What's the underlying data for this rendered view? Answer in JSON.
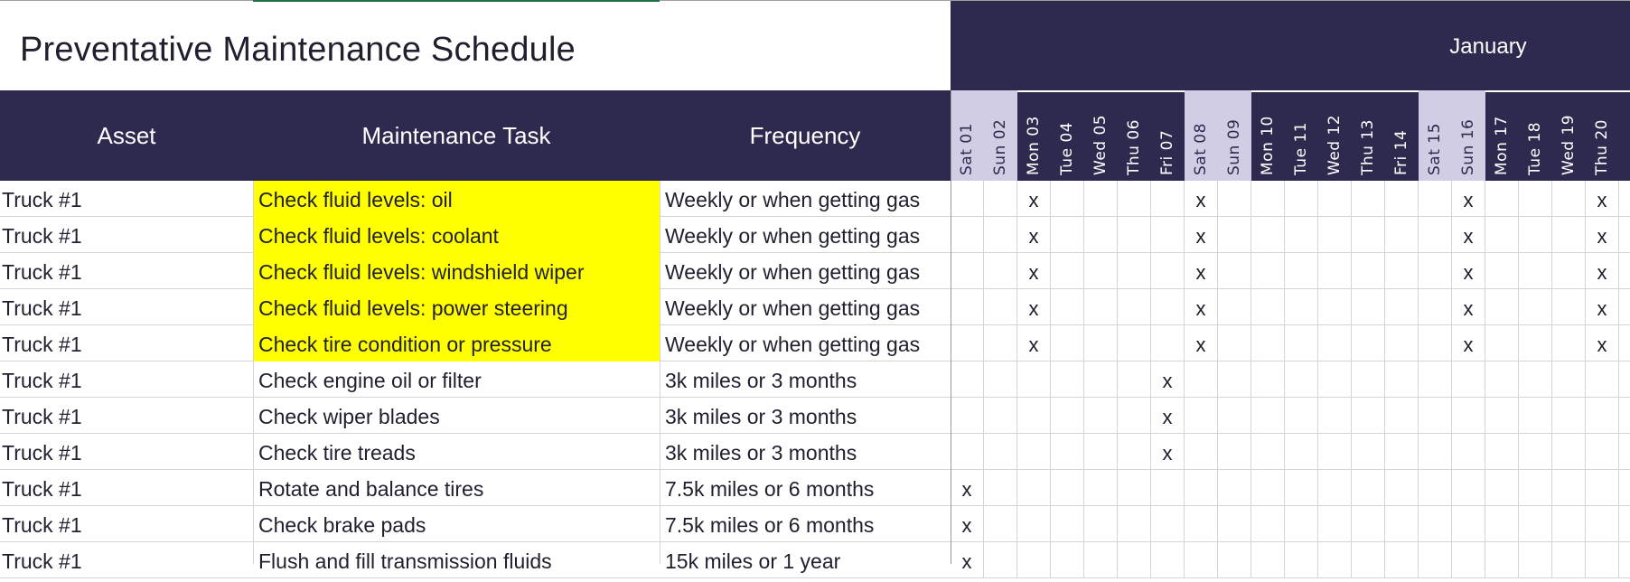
{
  "title": "Preventative Maintenance Schedule",
  "month": "January",
  "columns": {
    "asset": "Asset",
    "task": "Maintenance Task",
    "frequency": "Frequency"
  },
  "days": [
    {
      "label": "Sat 01",
      "weekend": true
    },
    {
      "label": "Sun 02",
      "weekend": true
    },
    {
      "label": "Mon 03",
      "weekend": false
    },
    {
      "label": "Tue 04",
      "weekend": false
    },
    {
      "label": "Wed 05",
      "weekend": false
    },
    {
      "label": "Thu 06",
      "weekend": false
    },
    {
      "label": "Fri 07",
      "weekend": false
    },
    {
      "label": "Sat 08",
      "weekend": true
    },
    {
      "label": "Sun 09",
      "weekend": true
    },
    {
      "label": "Mon 10",
      "weekend": false
    },
    {
      "label": "Tue 11",
      "weekend": false
    },
    {
      "label": "Wed 12",
      "weekend": false
    },
    {
      "label": "Thu 13",
      "weekend": false
    },
    {
      "label": "Fri 14",
      "weekend": false
    },
    {
      "label": "Sat 15",
      "weekend": true
    },
    {
      "label": "Sun 16",
      "weekend": true
    },
    {
      "label": "Mon 17",
      "weekend": false
    },
    {
      "label": "Tue 18",
      "weekend": false
    },
    {
      "label": "Wed 19",
      "weekend": false
    },
    {
      "label": "Thu 20",
      "weekend": false
    },
    {
      "label": "",
      "weekend": false
    }
  ],
  "mark": "x",
  "colors": {
    "header_bg": "#2e294e",
    "weekend_bg": "#d1cde4",
    "highlight": "#ffff00",
    "selection": "#1e7145"
  },
  "rows": [
    {
      "asset": "Truck #1",
      "task": "Check fluid levels: oil",
      "frequency": "Weekly or when getting gas",
      "highlight": true,
      "marks": [
        "Mon 03",
        "Sat 08",
        "Sun 16",
        "Thu 20"
      ]
    },
    {
      "asset": "Truck #1",
      "task": "Check fluid levels: coolant",
      "frequency": "Weekly or when getting gas",
      "highlight": true,
      "marks": [
        "Mon 03",
        "Sat 08",
        "Sun 16",
        "Thu 20"
      ]
    },
    {
      "asset": "Truck #1",
      "task": "Check fluid levels: windshield wiper",
      "frequency": "Weekly or when getting gas",
      "highlight": true,
      "marks": [
        "Mon 03",
        "Sat 08",
        "Sun 16",
        "Thu 20"
      ]
    },
    {
      "asset": "Truck #1",
      "task": "Check fluid levels: power steering",
      "frequency": "Weekly or when getting gas",
      "highlight": true,
      "marks": [
        "Mon 03",
        "Sat 08",
        "Sun 16",
        "Thu 20"
      ]
    },
    {
      "asset": "Truck #1",
      "task": "Check tire condition or pressure",
      "frequency": "Weekly or when getting gas",
      "highlight": true,
      "marks": [
        "Mon 03",
        "Sat 08",
        "Sun 16",
        "Thu 20"
      ]
    },
    {
      "asset": "Truck #1",
      "task": "Check engine oil or filter",
      "frequency": "3k miles or 3 months",
      "highlight": false,
      "marks": [
        "Fri 07"
      ]
    },
    {
      "asset": "Truck #1",
      "task": "Check wiper blades",
      "frequency": "3k miles or 3 months",
      "highlight": false,
      "marks": [
        "Fri 07"
      ]
    },
    {
      "asset": "Truck #1",
      "task": "Check tire treads",
      "frequency": "3k miles or 3 months",
      "highlight": false,
      "marks": [
        "Fri 07"
      ]
    },
    {
      "asset": "Truck #1",
      "task": "Rotate and balance tires",
      "frequency": "7.5k miles or 6 months",
      "highlight": false,
      "marks": [
        "Sat 01"
      ]
    },
    {
      "asset": "Truck #1",
      "task": "Check brake pads",
      "frequency": "7.5k miles or 6 months",
      "highlight": false,
      "marks": [
        "Sat 01"
      ]
    },
    {
      "asset": "Truck #1",
      "task": "Flush and fill transmission fluids",
      "frequency": "15k miles or 1 year",
      "highlight": false,
      "marks": [
        "Sat 01"
      ]
    }
  ]
}
